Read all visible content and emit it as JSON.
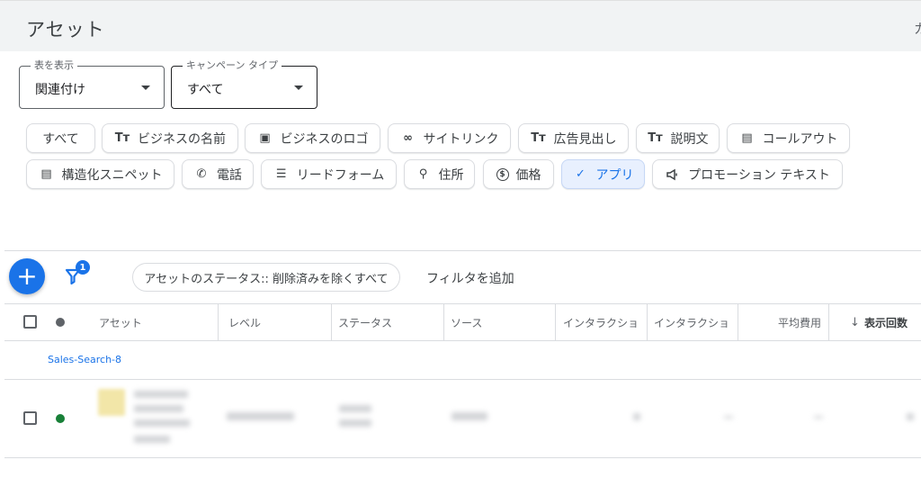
{
  "header": {
    "title": "アセット",
    "edge_text": "カ"
  },
  "selects": {
    "view": {
      "label": "表を表示",
      "value": "関連付け"
    },
    "campaign_type": {
      "label": "キャンペーン タイプ",
      "value": "すべて"
    }
  },
  "chips": [
    {
      "label": "すべて",
      "icon": "none",
      "glyph": ""
    },
    {
      "label": "ビジネスの名前",
      "icon": "text-format-icon",
      "glyph": "Tт"
    },
    {
      "label": "ビジネスのロゴ",
      "icon": "image-icon",
      "glyph": "▣"
    },
    {
      "label": "サイトリンク",
      "icon": "link-icon",
      "glyph": "∞"
    },
    {
      "label": "広告見出し",
      "icon": "text-format-icon",
      "glyph": "Tт"
    },
    {
      "label": "説明文",
      "icon": "text-format-icon",
      "glyph": "Tт"
    },
    {
      "label": "コールアウト",
      "icon": "document-icon",
      "glyph": "▤"
    },
    {
      "label": "構造化スニペット",
      "icon": "document-icon",
      "glyph": "▤"
    },
    {
      "label": "電話",
      "icon": "phone-icon",
      "glyph": "✆"
    },
    {
      "label": "リードフォーム",
      "icon": "form-icon",
      "glyph": "☰"
    },
    {
      "label": "住所",
      "icon": "location-pin-icon",
      "glyph": "⚲"
    },
    {
      "label": "価格",
      "icon": "price-icon",
      "glyph": "$"
    },
    {
      "label": "アプリ",
      "icon": "check-icon",
      "glyph": "✓",
      "selected": true
    },
    {
      "label": "プロモーション テキスト",
      "icon": "megaphone-icon",
      "glyph": "📢"
    }
  ],
  "toolbar": {
    "add": "+",
    "filter_count": "1",
    "filter_pill": "アセットのステータス:: 削除済みを除くすべて",
    "add_filter": "フィルタを追加"
  },
  "table": {
    "columns": [
      "アセット",
      "レベル",
      "ステータス",
      "ソース",
      "インタラクショ",
      "インタラクショ",
      "平均費用",
      "表示回数"
    ],
    "sort_arrow": "↓",
    "group": "Sales-Search-8"
  },
  "colors": {
    "accent": "#1a73e8",
    "status_enabled": "#188038",
    "header_bg": "#f1f3f4"
  }
}
